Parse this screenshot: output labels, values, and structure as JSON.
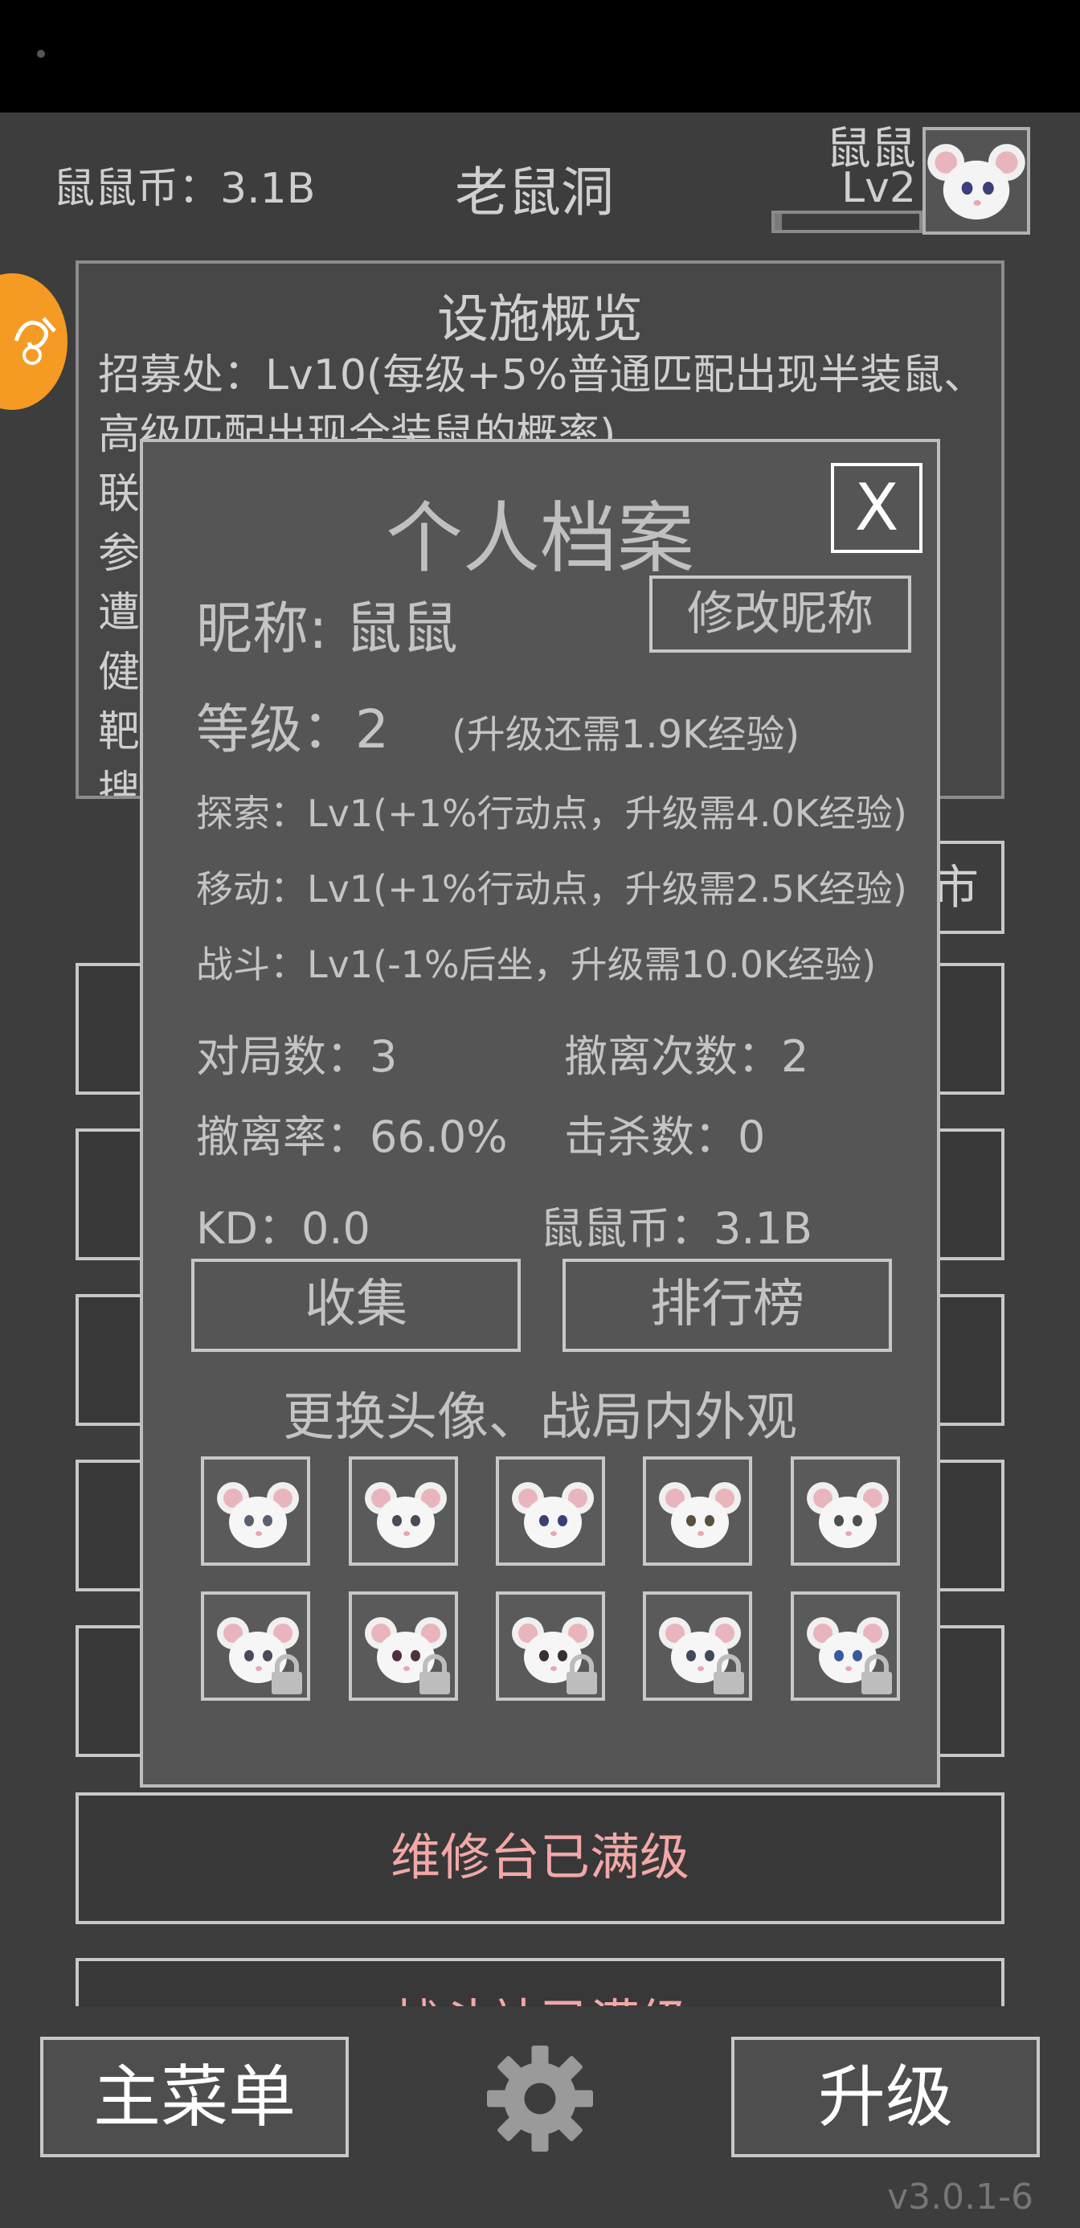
{
  "header": {
    "coins_label": "鼠鼠币：3.1B",
    "title": "老鼠洞",
    "player_name": "鼠鼠",
    "player_level": "Lv2",
    "xp_progress": 0.05
  },
  "facilities": {
    "title": "设施概览",
    "lines": [
      "招募处：Lv10(每级+5%普通匹配出现半装鼠、高级匹配出现全装鼠的概率)",
      "联",
      "参",
      "遭",
      "健",
      "靶",
      "搜"
    ]
  },
  "background": {
    "side_button_label": "市",
    "repair_row_label": "维修台已满级",
    "row_below_label": "战斗站已满级"
  },
  "modal": {
    "title": "个人档案",
    "close_label": "X",
    "nickname_label": "昵称: 鼠鼠",
    "edit_nickname_label": "修改昵称",
    "level_label": "等级：2",
    "level_hint": "(升级还需1.9K经验)",
    "skills": [
      "探索：Lv1(+1%行动点，升级需4.0K经验)",
      "移动：Lv1(+1%行动点，升级需2.5K经验)",
      "战斗：Lv1(-1%后坐，升级需10.0K经验)"
    ],
    "stats": {
      "matches": "对局数：3",
      "extractions": "撤离次数：2",
      "extraction_rate": "撤离率：66.0%",
      "kills": "击杀数：0",
      "kd": "KD：0.0",
      "coins": "鼠鼠币：3.1B"
    },
    "collect_label": "收集",
    "leaderboard_label": "排行榜",
    "appearance_title": "更换头像、战局内外观",
    "avatars": [
      {
        "locked": false,
        "eye": "#5a6070"
      },
      {
        "locked": false,
        "eye": "#4a4a58"
      },
      {
        "locked": false,
        "eye": "#3a3f7a"
      },
      {
        "locked": false,
        "eye": "#5a5040"
      },
      {
        "locked": false,
        "eye": "#4a5050"
      },
      {
        "locked": true,
        "eye": "#4a4a58"
      },
      {
        "locked": true,
        "eye": "#503040"
      },
      {
        "locked": true,
        "eye": "#3a3030"
      },
      {
        "locked": true,
        "eye": "#404a58"
      },
      {
        "locked": true,
        "eye": "#3a5aa0"
      }
    ]
  },
  "bottom": {
    "main_menu_label": "主菜单",
    "upgrade_label": "升级",
    "version": "v3.0.1-6"
  },
  "colors": {
    "background": "#3d3d3d",
    "modal_bg": "#555555",
    "accent_orange": "#f59a23",
    "maxed_text": "#f3a7a7"
  }
}
